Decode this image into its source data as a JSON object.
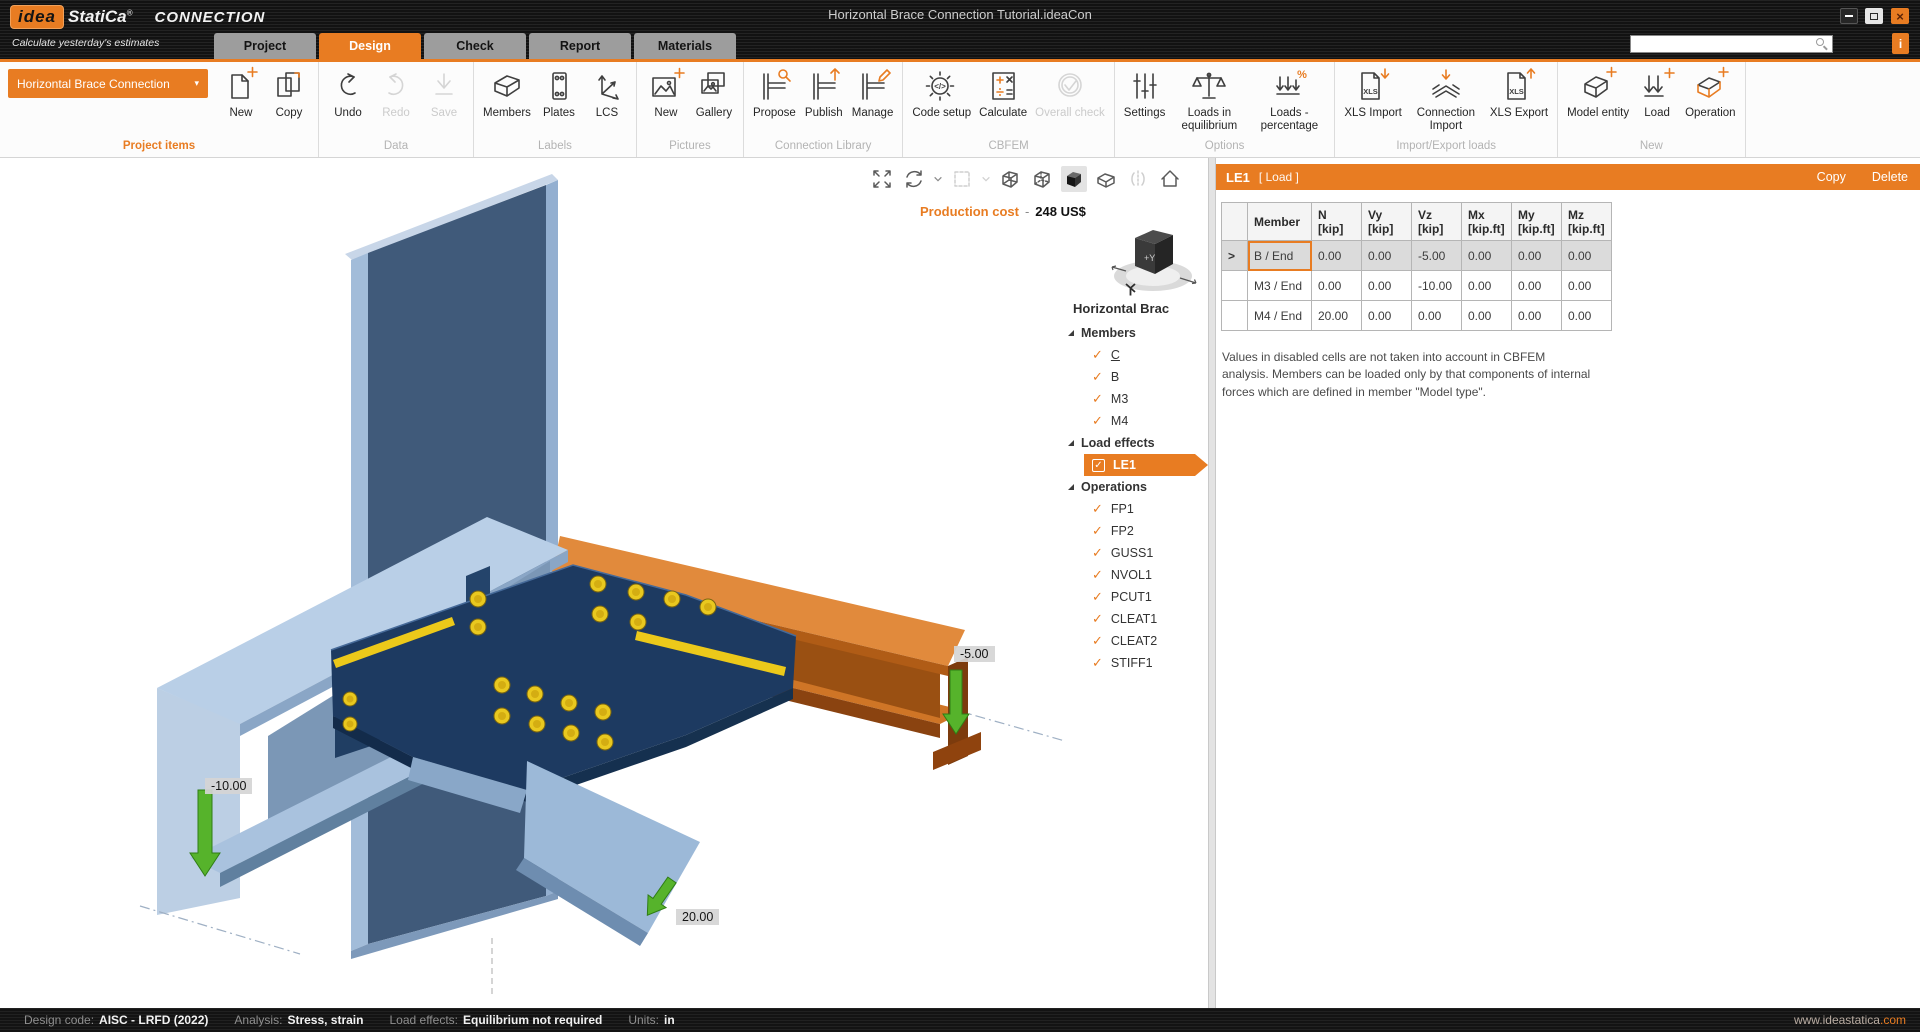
{
  "titlebar": {
    "logo_idea": "idea",
    "logo_statica": "StatiCa",
    "logo_reg": "®",
    "logo_product": "CONNECTION",
    "tagline": "Calculate yesterday's estimates",
    "window_title": "Horizontal Brace Connection Tutorial.ideaCon",
    "info_button": "i"
  },
  "tabs": [
    {
      "label": "Project"
    },
    {
      "label": "Design"
    },
    {
      "label": "Check"
    },
    {
      "label": "Report"
    },
    {
      "label": "Materials"
    }
  ],
  "ribbon": {
    "project_dropdown": "Horizontal Brace Connection",
    "groups": [
      {
        "name": "Project items",
        "items": [
          {
            "label": "New"
          },
          {
            "label": "Copy"
          }
        ]
      },
      {
        "name": "Data",
        "items": [
          {
            "label": "Undo"
          },
          {
            "label": "Redo"
          },
          {
            "label": "Save"
          }
        ]
      },
      {
        "name": "Labels",
        "items": [
          {
            "label": "Members"
          },
          {
            "label": "Plates"
          },
          {
            "label": "LCS"
          }
        ]
      },
      {
        "name": "Pictures",
        "items": [
          {
            "label": "New"
          },
          {
            "label": "Gallery"
          }
        ]
      },
      {
        "name": "Connection Library",
        "items": [
          {
            "label": "Propose"
          },
          {
            "label": "Publish"
          },
          {
            "label": "Manage"
          }
        ]
      },
      {
        "name": "CBFEM",
        "items": [
          {
            "label": "Code setup"
          },
          {
            "label": "Calculate"
          },
          {
            "label": "Overall check"
          }
        ]
      },
      {
        "name": "Options",
        "items": [
          {
            "label": "Settings"
          },
          {
            "label": "Loads in equilibrium"
          },
          {
            "label": "Loads - percentage"
          }
        ]
      },
      {
        "name": "Import/Export loads",
        "items": [
          {
            "label": "XLS Import"
          },
          {
            "label": "Connection Import"
          },
          {
            "label": "XLS Export"
          }
        ]
      },
      {
        "name": "New",
        "items": [
          {
            "label": "Model entity"
          },
          {
            "label": "Load"
          },
          {
            "label": "Operation"
          }
        ]
      }
    ]
  },
  "viewport": {
    "production_cost": {
      "label": "Production cost",
      "separator": "-",
      "value": "248 US$"
    },
    "load_labels": [
      {
        "value": "-10.00"
      },
      {
        "value": "-5.00"
      },
      {
        "value": "20.00"
      }
    ],
    "view_cube": {
      "front_face": "+Y"
    }
  },
  "tree": {
    "title": "Horizontal Brac",
    "sections": [
      {
        "label": "Members",
        "items": [
          {
            "label": "C"
          },
          {
            "label": "B"
          },
          {
            "label": "M3"
          },
          {
            "label": "M4"
          }
        ]
      },
      {
        "label": "Load effects",
        "items": [
          {
            "label": "LE1"
          }
        ]
      },
      {
        "label": "Operations",
        "items": [
          {
            "label": "FP1"
          },
          {
            "label": "FP2"
          },
          {
            "label": "GUSS1"
          },
          {
            "label": "NVOL1"
          },
          {
            "label": "PCUT1"
          },
          {
            "label": "CLEAT1"
          },
          {
            "label": "CLEAT2"
          },
          {
            "label": "STIFF1"
          }
        ]
      }
    ]
  },
  "load_panel": {
    "title": "LE1",
    "subtitle": "[ Load ]",
    "copy_label": "Copy",
    "delete_label": "Delete",
    "expander": ">",
    "table": {
      "headers": [
        {
          "name": "Member",
          "unit": ""
        },
        {
          "name": "N",
          "unit": "[kip]"
        },
        {
          "name": "Vy",
          "unit": "[kip]"
        },
        {
          "name": "Vz",
          "unit": "[kip]"
        },
        {
          "name": "Mx",
          "unit": "[kip.ft]"
        },
        {
          "name": "My",
          "unit": "[kip.ft]"
        },
        {
          "name": "Mz",
          "unit": "[kip.ft]"
        }
      ],
      "rows": [
        {
          "member": "B / End",
          "n": "0.00",
          "vy": "0.00",
          "vz": "-5.00",
          "mx": "0.00",
          "my": "0.00",
          "mz": "0.00"
        },
        {
          "member": "M3 / End",
          "n": "0.00",
          "vy": "0.00",
          "vz": "-10.00",
          "mx": "0.00",
          "my": "0.00",
          "mz": "0.00"
        },
        {
          "member": "M4 / End",
          "n": "20.00",
          "vy": "0.00",
          "vz": "0.00",
          "mx": "0.00",
          "my": "0.00",
          "mz": "0.00"
        }
      ]
    },
    "note": "Values in disabled cells are not taken into account in CBFEM analysis. Members can be loaded only by that components of internal forces which are defined in member \"Model type\"."
  },
  "status_bar": {
    "items": [
      {
        "label": "Design code:",
        "value": "AISC - LRFD (2022)"
      },
      {
        "label": "Analysis:",
        "value": "Stress, strain"
      },
      {
        "label": "Load effects:",
        "value": "Equilibrium not required"
      },
      {
        "label": "Units:",
        "value": "in"
      }
    ],
    "website_prefix": "www.ideastatica",
    "website_suffix": ".com"
  },
  "colors": {
    "accent": "#e87c22",
    "steel_blue": "#8aa6c6",
    "gusset_navy": "#1d3a61",
    "beam_orange": "#d2711f",
    "bolt_yellow": "#e9c81f",
    "arrow_green": "#56b32b"
  }
}
